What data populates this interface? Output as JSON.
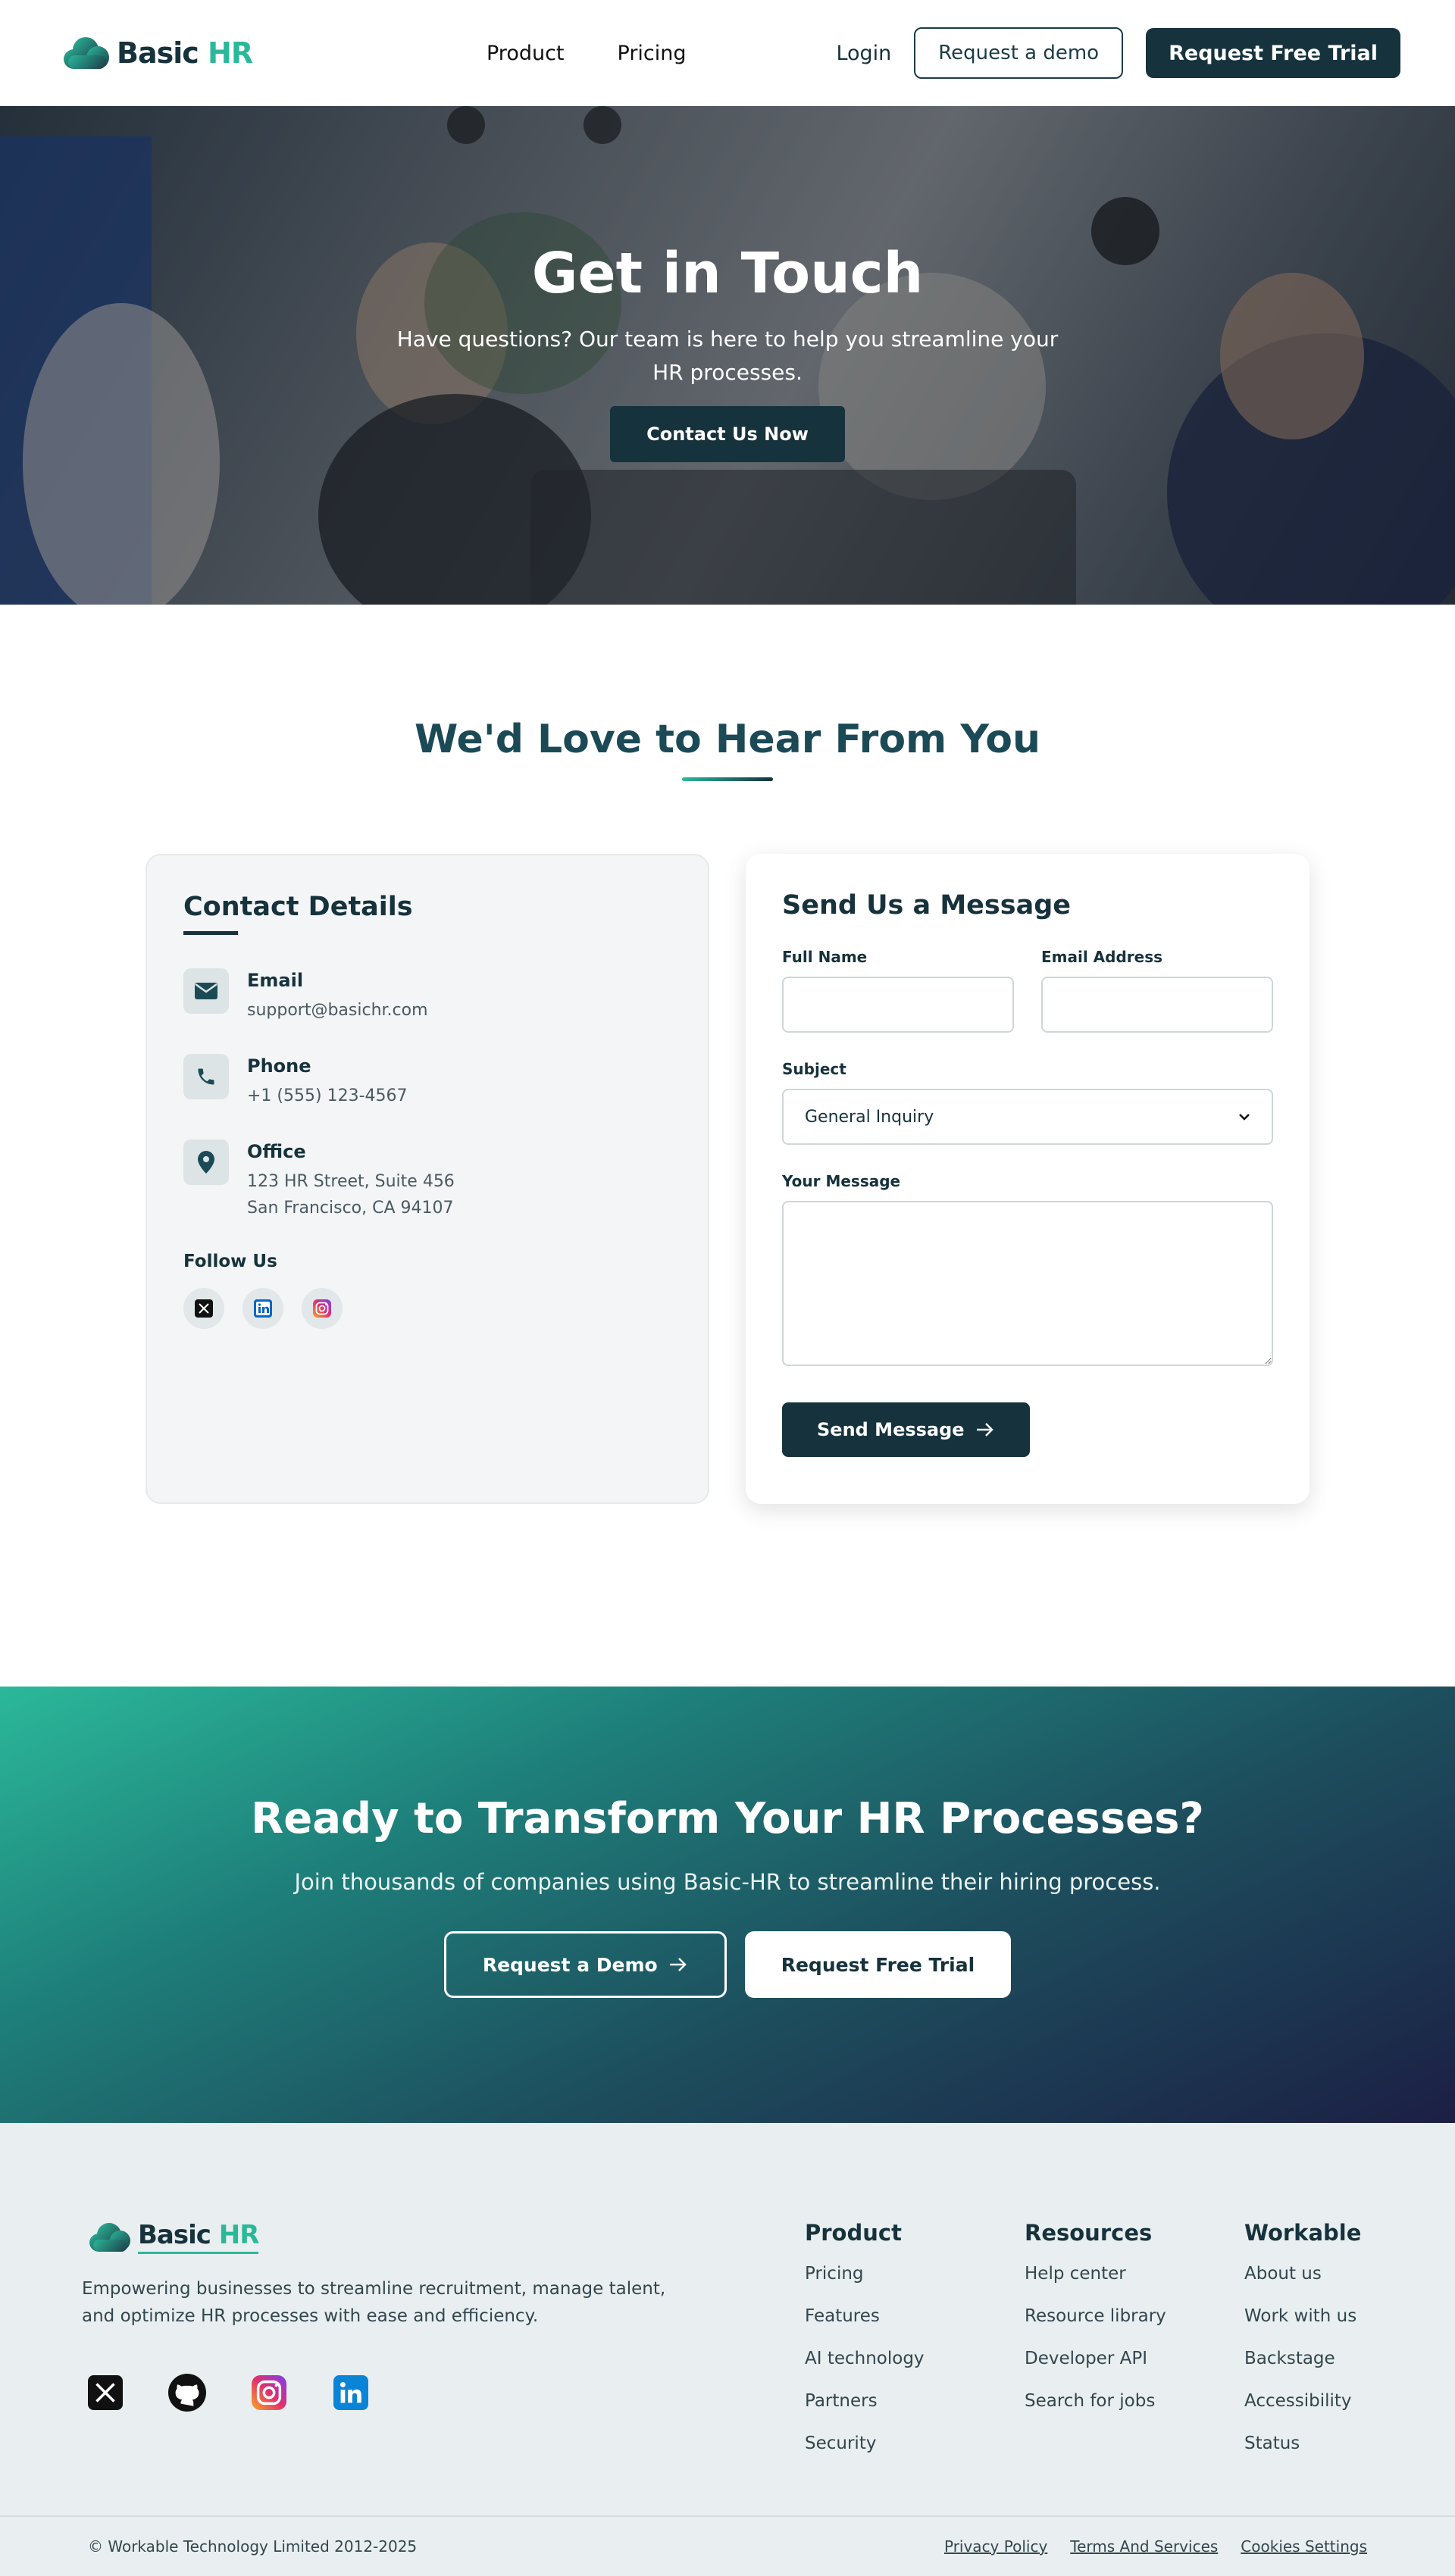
{
  "brand": {
    "name": "Basic",
    "suffix": "HR"
  },
  "nav": {
    "links": [
      "Product",
      "Pricing"
    ],
    "login": "Login",
    "demo": "Request a demo",
    "trial": "Request Free Trial"
  },
  "hero": {
    "title": "Get in Touch",
    "subtitle": "Have questions? Our team is here to help you streamline your HR processes.",
    "cta": "Contact Us Now"
  },
  "contact": {
    "title": "We'd Love to Hear From You",
    "details_title": "Contact Details",
    "email_label": "Email",
    "email_value": "support@basichr.com",
    "phone_label": "Phone",
    "phone_value": "+1 (555) 123-4567",
    "office_label": "Office",
    "office_line1": "123 HR Street, Suite 456",
    "office_line2": "San Francisco, CA 94107",
    "follow": "Follow Us"
  },
  "form": {
    "title": "Send Us a Message",
    "full_name_label": "Full Name",
    "full_name_value": "",
    "email_label": "Email Address",
    "email_value": "",
    "subject_label": "Subject",
    "subject_value": "General Inquiry",
    "message_label": "Your Message",
    "message_value": "",
    "submit": "Send Message"
  },
  "cta": {
    "title": "Ready to Transform Your HR Processes?",
    "subtitle": "Join thousands of companies using Basic-HR to streamline their hiring process.",
    "demo": "Request a Demo",
    "trial": "Request Free Trial"
  },
  "footer": {
    "description": "Empowering businesses to streamline recruitment, manage talent, and optimize HR processes with ease and efficiency.",
    "columns": [
      {
        "title": "Product",
        "items": [
          "Pricing",
          "Features",
          "AI technology",
          "Partners",
          "Security"
        ]
      },
      {
        "title": "Resources",
        "items": [
          "Help center",
          "Resource library",
          "Developer API",
          "Search for jobs"
        ]
      },
      {
        "title": "Workable",
        "items": [
          "About us",
          "Work with us",
          "Backstage",
          "Accessibility",
          "Status"
        ]
      }
    ],
    "copyright": "© Workable Technology Limited 2012-2025",
    "legal": [
      "Privacy Policy",
      "Terms And Services",
      "Cookies Settings"
    ]
  },
  "colors": {
    "primary": "#16323c",
    "accent": "#2bb89a",
    "heading": "#1b4a56"
  }
}
